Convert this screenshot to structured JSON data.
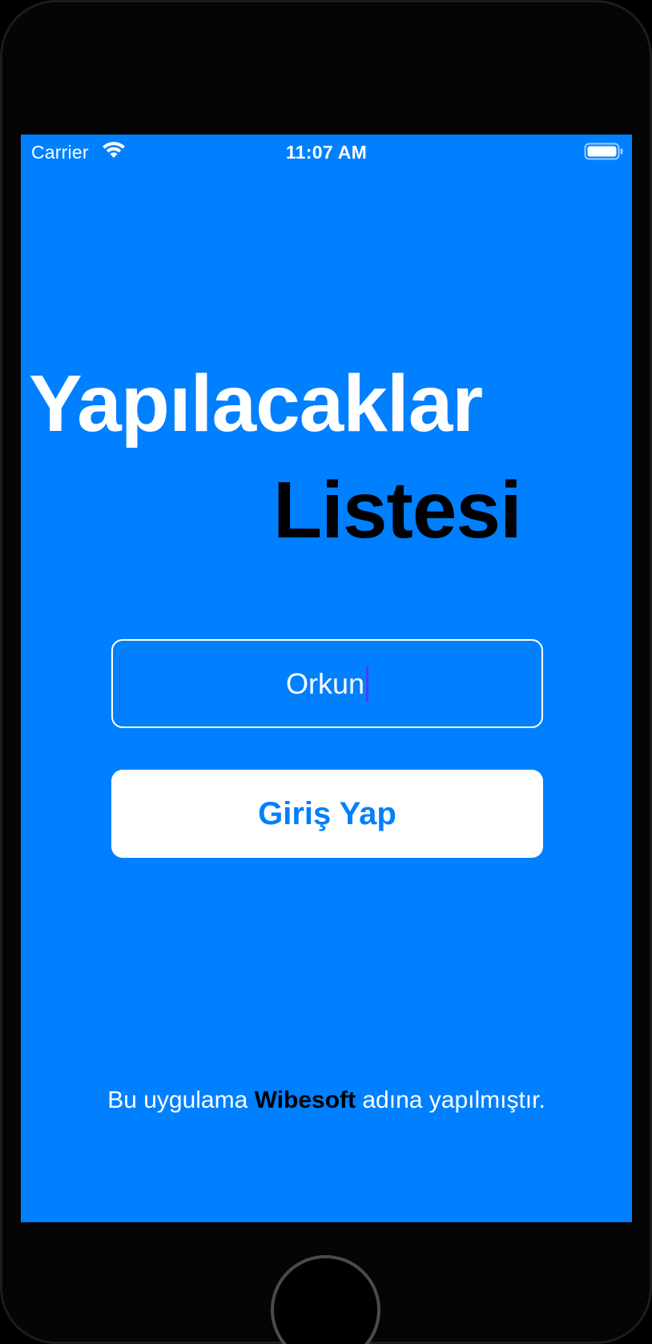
{
  "theme": {
    "accent": "#0080FF",
    "caret": "#4A3CFF"
  },
  "status_bar": {
    "carrier": "Carrier",
    "time": "11:07 AM",
    "wifi_icon": "wifi-icon",
    "battery_icon": "battery-icon"
  },
  "title": {
    "line1": "Yapılacaklar",
    "line2": "Listesi"
  },
  "name_field": {
    "value": "Orkun"
  },
  "login_button": {
    "label": "Giriş Yap"
  },
  "footer": {
    "prefix": "Bu uygulama ",
    "brand": "Wibesoft",
    "suffix": "  adına yapılmıştır."
  }
}
